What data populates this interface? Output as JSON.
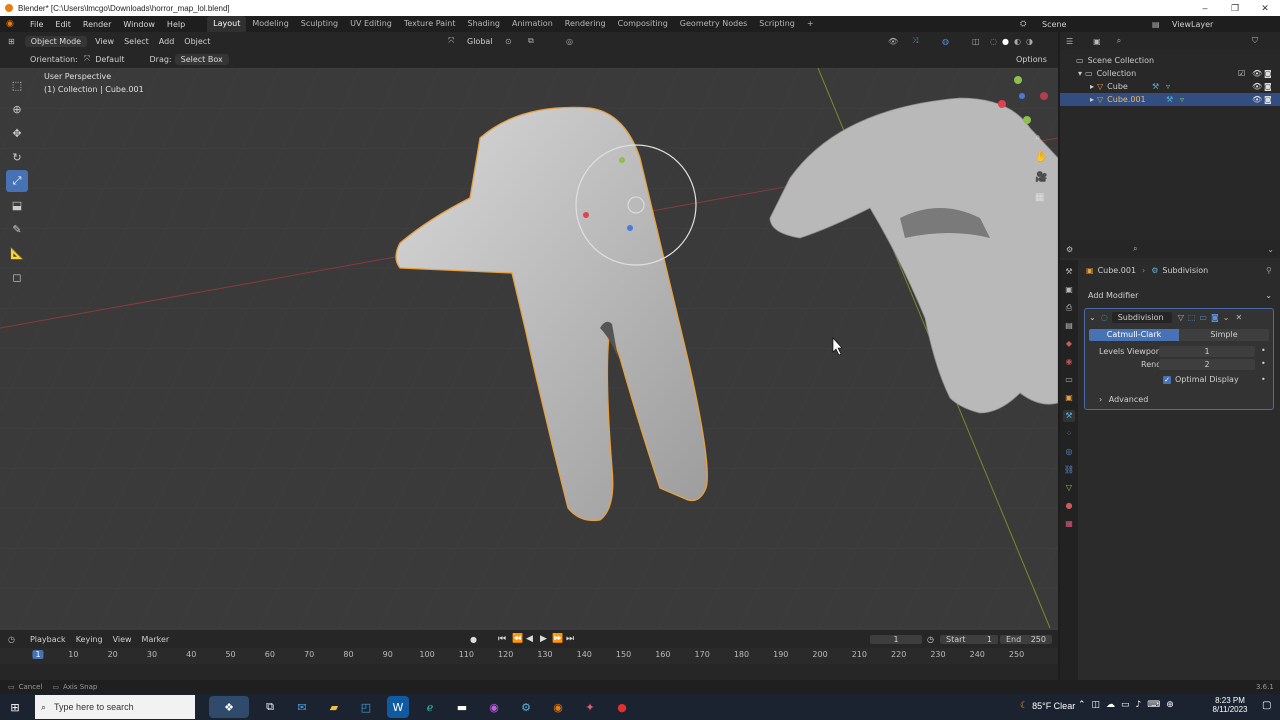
{
  "window": {
    "title": "Blender* [C:\\Users\\lmcgo\\Downloads\\horror_map_lol.blend]",
    "minimize": "–",
    "maximize": "❐",
    "close": "✕"
  },
  "menu": [
    "File",
    "Edit",
    "Render",
    "Window",
    "Help"
  ],
  "workspaces": [
    "Layout",
    "Modeling",
    "Sculpting",
    "UV Editing",
    "Texture Paint",
    "Shading",
    "Animation",
    "Rendering",
    "Compositing",
    "Geometry Nodes",
    "Scripting",
    "+"
  ],
  "scene": {
    "label": "Scene",
    "viewlayer": "ViewLayer"
  },
  "viewport_header": {
    "mode": "Object Mode",
    "items": [
      "View",
      "Select",
      "Add",
      "Object"
    ],
    "transform": "Global",
    "orientation_label": "Orientation:",
    "orientation_value": "Default",
    "drag_label": "Drag:",
    "drag_value": "Select Box",
    "options": "Options"
  },
  "viewport": {
    "perspective": "User Perspective",
    "collection": "(1) Collection | Cube.001"
  },
  "outliner": {
    "root": "Scene Collection",
    "items": [
      {
        "label": "Collection",
        "selected": false
      },
      {
        "label": "Cube",
        "selected": false
      },
      {
        "label": "Cube.001",
        "selected": true
      }
    ]
  },
  "properties": {
    "object": "Cube.001",
    "modifier_crumb": "Subdivision",
    "add_modifier": "Add Modifier",
    "modifier_name": "Subdivision",
    "tab_catmull": "Catmull-Clark",
    "tab_simple": "Simple",
    "levels_label": "Levels Viewport",
    "levels_value": "1",
    "render_label": "Render",
    "render_value": "2",
    "optimal_label": "Optimal Display",
    "advanced": "Advanced"
  },
  "timeline": {
    "menus": [
      "Playback",
      "Keying",
      "View",
      "Marker"
    ],
    "current_frame": "1",
    "start_label": "Start",
    "start": "1",
    "end_label": "End",
    "end": "250",
    "ticks": [
      "1",
      "10",
      "20",
      "30",
      "40",
      "50",
      "60",
      "70",
      "80",
      "90",
      "100",
      "110",
      "120",
      "130",
      "140",
      "150",
      "160",
      "170",
      "180",
      "190",
      "200",
      "210",
      "220",
      "230",
      "240",
      "250"
    ]
  },
  "status": {
    "left": "Cancel",
    "mid": "Axis Snap",
    "version": "3.6.1"
  },
  "taskbar": {
    "search_placeholder": "Type here to search",
    "weather": "85°F  Clear",
    "time": "8:23 PM",
    "date": "8/11/2023"
  },
  "colors": {
    "accent": "#4772b3",
    "selection_outline": "#e8a040",
    "viewport_bg": "#3a3a3a"
  }
}
